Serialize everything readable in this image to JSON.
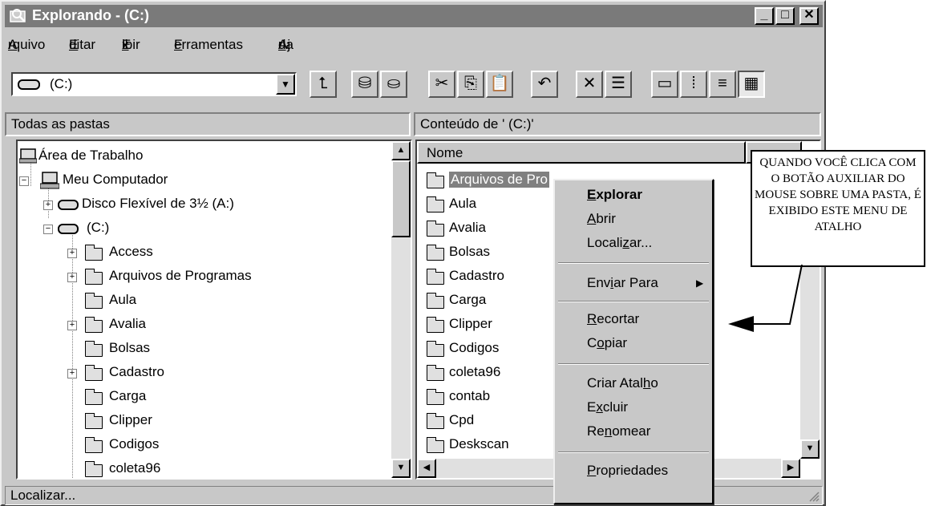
{
  "window": {
    "title": "Explorando -  (C:)"
  },
  "menu": [
    {
      "pre": "",
      "u": "A",
      "post": "rquivo"
    },
    {
      "pre": "",
      "u": "E",
      "post": "ditar"
    },
    {
      "pre": "E",
      "u": "x",
      "post": "ibir"
    },
    {
      "pre": "",
      "u": "F",
      "post": "erramentas"
    },
    {
      "pre": "Aj",
      "u": "u",
      "post": "da"
    }
  ],
  "address": {
    "value": "(C:)"
  },
  "left_header": "Todas as pastas",
  "right_header": "Conteúdo de ' (C:)'",
  "tree": {
    "items": [
      "Área de Trabalho",
      "Meu Computador",
      "Disco Flexível de 3½ (A:)",
      "(C:)",
      "Access",
      "Arquivos de Programas",
      "Aula",
      "Avalia",
      "Bolsas",
      "Cadastro",
      "Carga",
      "Clipper",
      "Codigos",
      "coleta96"
    ]
  },
  "list": {
    "column_name": "Nome",
    "items": [
      "Arquivos de Pro",
      "Aula",
      "Avalia",
      "Bolsas",
      "Cadastro",
      "Carga",
      "Clipper",
      "Codigos",
      "coleta96",
      "contab",
      "Cpd",
      "Deskscan"
    ]
  },
  "context_menu": {
    "items": [
      {
        "pre": "",
        "u": "E",
        "post": "xplorar"
      },
      {
        "pre": "",
        "u": "A",
        "post": "brir"
      },
      {
        "pre": "Locali",
        "u": "z",
        "post": "ar..."
      },
      {
        "pre": "Env",
        "u": "i",
        "post": "ar Para"
      },
      {
        "pre": "",
        "u": "R",
        "post": "ecortar"
      },
      {
        "pre": "C",
        "u": "o",
        "post": "piar"
      },
      {
        "pre": "Criar Atal",
        "u": "h",
        "post": "o"
      },
      {
        "pre": "E",
        "u": "x",
        "post": "cluir"
      },
      {
        "pre": "Re",
        "u": "n",
        "post": "omear"
      },
      {
        "pre": "",
        "u": "P",
        "post": "ropriedades"
      }
    ]
  },
  "status": "Localizar...",
  "callout": "QUANDO VOCÊ CLICA COM O BOTÃO AUXILIAR DO MOUSE SOBRE UMA PASTA, É EXIBIDO ESTE MENU DE ATALHO"
}
